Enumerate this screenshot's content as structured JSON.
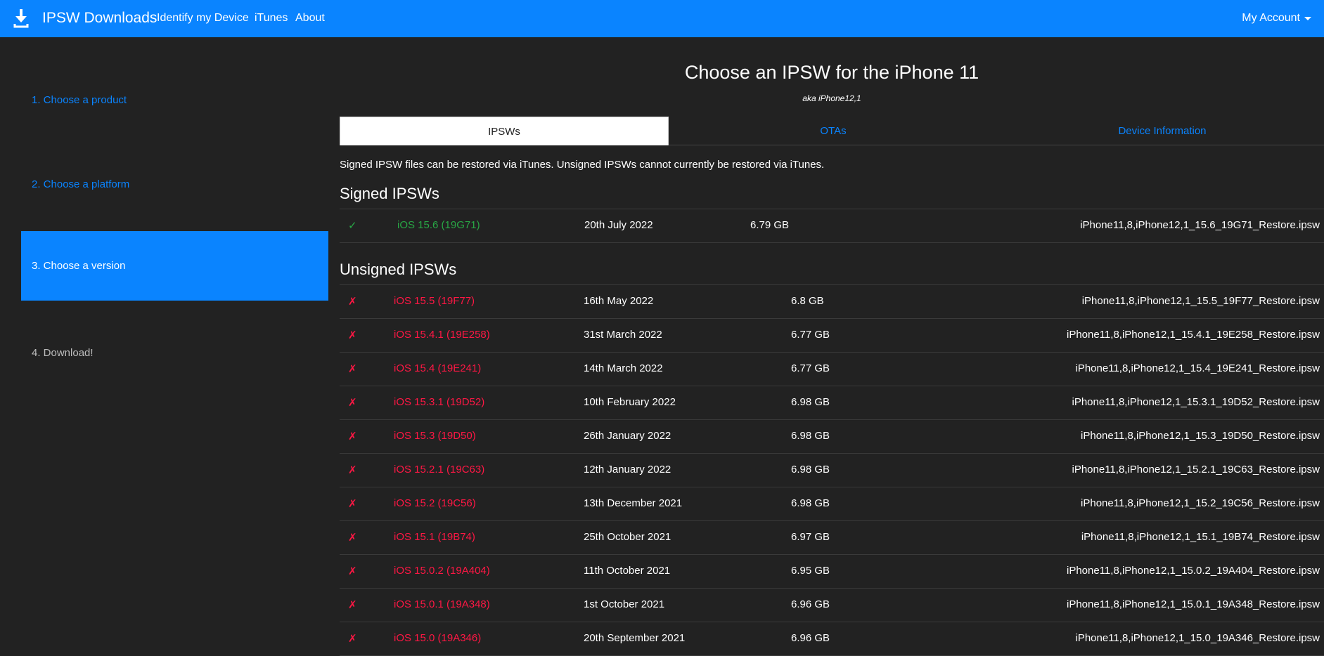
{
  "nav": {
    "brand": "IPSW Downloads",
    "links": [
      "Identify my Device",
      "iTunes",
      "About"
    ],
    "account": "My Account"
  },
  "sidebar": {
    "steps": [
      {
        "label": "1. Choose a product",
        "state": "link"
      },
      {
        "label": "2. Choose a platform",
        "state": "link"
      },
      {
        "label": "3. Choose a version",
        "state": "active"
      },
      {
        "label": "4. Download!",
        "state": "muted"
      }
    ]
  },
  "main": {
    "title": "Choose an IPSW for the iPhone 11",
    "subtitle": "aka iPhone12,1",
    "tabs": [
      "IPSWs",
      "OTAs",
      "Device Information"
    ],
    "notice": "Signed IPSW files can be restored via iTunes. Unsigned IPSWs cannot currently be restored via iTunes.",
    "signed_title": "Signed IPSWs",
    "unsigned_title": "Unsigned IPSWs",
    "signed": [
      {
        "mark": "✓",
        "version": "iOS 15.6 (19G71)",
        "date": "20th July 2022",
        "size": "6.79 GB",
        "file": "iPhone11,8,iPhone12,1_15.6_19G71_Restore.ipsw"
      }
    ],
    "unsigned": [
      {
        "mark": "✗",
        "version": "iOS 15.5 (19F77)",
        "date": "16th May 2022",
        "size": "6.8 GB",
        "file": "iPhone11,8,iPhone12,1_15.5_19F77_Restore.ipsw"
      },
      {
        "mark": "✗",
        "version": "iOS 15.4.1 (19E258)",
        "date": "31st March 2022",
        "size": "6.77 GB",
        "file": "iPhone11,8,iPhone12,1_15.4.1_19E258_Restore.ipsw"
      },
      {
        "mark": "✗",
        "version": "iOS 15.4 (19E241)",
        "date": "14th March 2022",
        "size": "6.77 GB",
        "file": "iPhone11,8,iPhone12,1_15.4_19E241_Restore.ipsw"
      },
      {
        "mark": "✗",
        "version": "iOS 15.3.1 (19D52)",
        "date": "10th February 2022",
        "size": "6.98 GB",
        "file": "iPhone11,8,iPhone12,1_15.3.1_19D52_Restore.ipsw"
      },
      {
        "mark": "✗",
        "version": "iOS 15.3 (19D50)",
        "date": "26th January 2022",
        "size": "6.98 GB",
        "file": "iPhone11,8,iPhone12,1_15.3_19D50_Restore.ipsw"
      },
      {
        "mark": "✗",
        "version": "iOS 15.2.1 (19C63)",
        "date": "12th January 2022",
        "size": "6.98 GB",
        "file": "iPhone11,8,iPhone12,1_15.2.1_19C63_Restore.ipsw"
      },
      {
        "mark": "✗",
        "version": "iOS 15.2 (19C56)",
        "date": "13th December 2021",
        "size": "6.98 GB",
        "file": "iPhone11,8,iPhone12,1_15.2_19C56_Restore.ipsw"
      },
      {
        "mark": "✗",
        "version": "iOS 15.1 (19B74)",
        "date": "25th October 2021",
        "size": "6.97 GB",
        "file": "iPhone11,8,iPhone12,1_15.1_19B74_Restore.ipsw"
      },
      {
        "mark": "✗",
        "version": "iOS 15.0.2 (19A404)",
        "date": "11th October 2021",
        "size": "6.95 GB",
        "file": "iPhone11,8,iPhone12,1_15.0.2_19A404_Restore.ipsw"
      },
      {
        "mark": "✗",
        "version": "iOS 15.0.1 (19A348)",
        "date": "1st October 2021",
        "size": "6.96 GB",
        "file": "iPhone11,8,iPhone12,1_15.0.1_19A348_Restore.ipsw"
      },
      {
        "mark": "✗",
        "version": "iOS 15.0 (19A346)",
        "date": "20th September 2021",
        "size": "6.96 GB",
        "file": "iPhone11,8,iPhone12,1_15.0_19A346_Restore.ipsw"
      }
    ]
  },
  "colors": {
    "accent": "#0a84ff",
    "signed": "#28a745",
    "unsigned": "#ff1744",
    "background": "#222222"
  }
}
